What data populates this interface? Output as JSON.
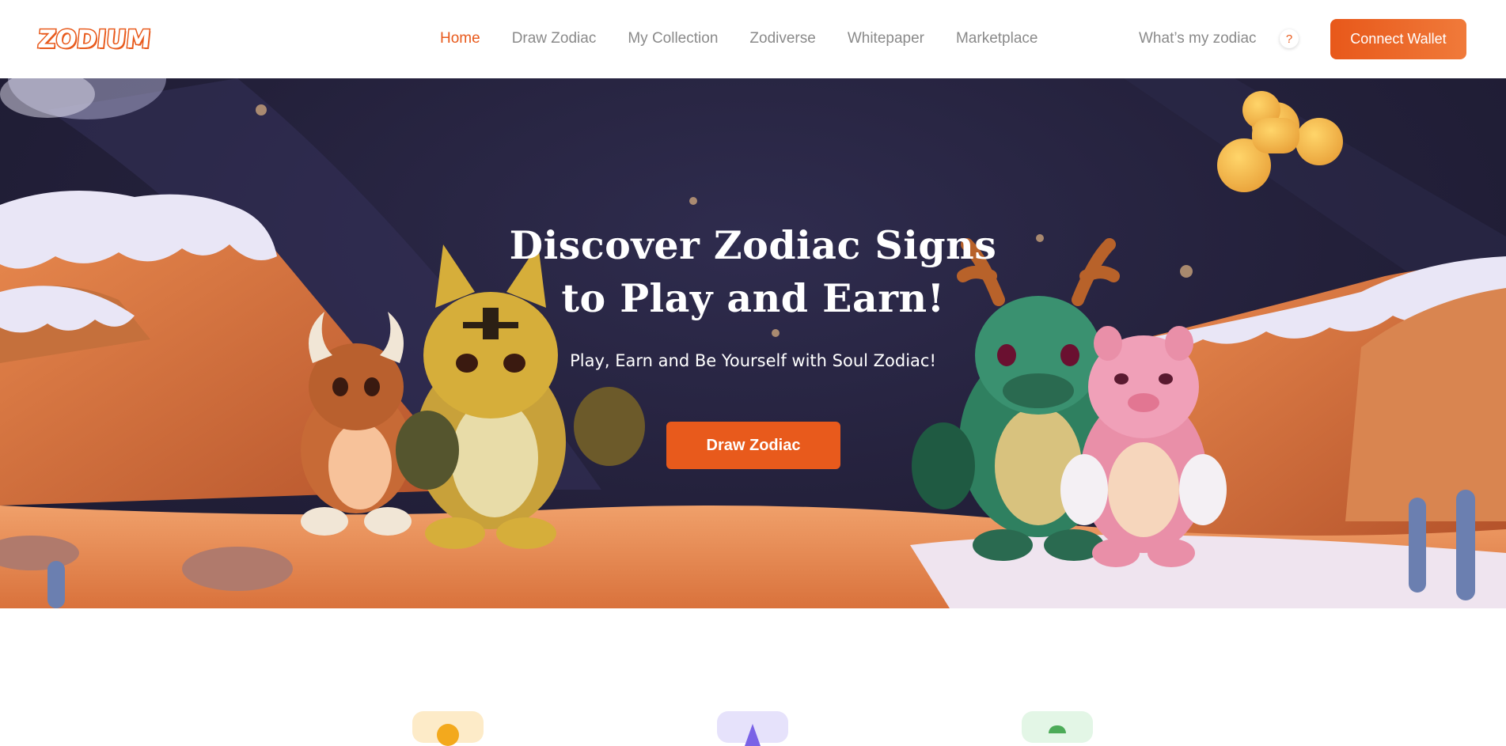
{
  "header": {
    "logo_text": "ZODIUM",
    "nav": [
      {
        "label": "Home",
        "active": true
      },
      {
        "label": "Draw Zodiac",
        "active": false
      },
      {
        "label": "My Collection",
        "active": false
      },
      {
        "label": "Zodiverse",
        "active": false
      },
      {
        "label": "Whitepaper",
        "active": false
      },
      {
        "label": "Marketplace",
        "active": false
      }
    ],
    "zodiac_link": "What’s my zodiac",
    "help_icon": "?",
    "connect_wallet": "Connect Wallet"
  },
  "hero": {
    "title_line1": "Discover Zodiac Signs",
    "title_line2": "to Play and Earn!",
    "subtitle": "Play, Earn and Be Yourself with Soul Zodiac!",
    "cta": "Draw Zodiac"
  },
  "features": [
    {
      "icon": "coin-icon"
    },
    {
      "icon": "triangle-icon"
    },
    {
      "icon": "leaf-icon"
    }
  ],
  "colors": {
    "accent": "#e85a1c",
    "nav_text": "#8a8a8a",
    "hero_bg": "#23203a"
  }
}
